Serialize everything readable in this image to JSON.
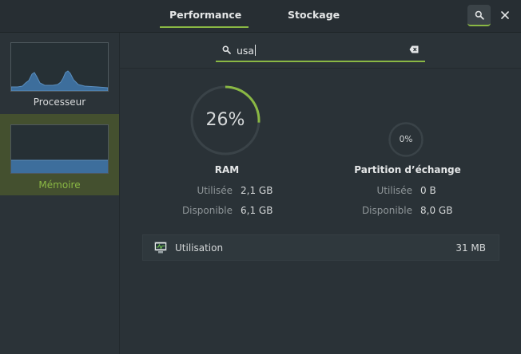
{
  "header": {
    "tabs": [
      {
        "label": "Performance",
        "active": true
      },
      {
        "label": "Stockage",
        "active": false
      }
    ],
    "search_icon": "search-icon",
    "close_icon": "close-icon"
  },
  "sidebar": {
    "items": [
      {
        "label": "Processeur",
        "selected": false
      },
      {
        "label": "Mémoire",
        "selected": true
      }
    ]
  },
  "search": {
    "value": "usa",
    "clear_icon": "backspace-clear-icon"
  },
  "memory": {
    "ram": {
      "title": "RAM",
      "percent_label": "26%",
      "percent": 26,
      "used_label": "Utilisée",
      "used_value": "2,1 GB",
      "available_label": "Disponible",
      "available_value": "6,1 GB"
    },
    "swap": {
      "title": "Partition d’échange",
      "percent_label": "0%",
      "percent": 0,
      "used_label": "Utilisée",
      "used_value": "0 B",
      "available_label": "Disponible",
      "available_value": "8,0 GB"
    }
  },
  "processes": [
    {
      "name": "Utilisation",
      "value": "31 MB",
      "icon": "system-monitor-icon"
    }
  ],
  "colors": {
    "accent": "#8ab844",
    "selected_bg": "#44502f",
    "graph_blue": "#3d6e9c"
  }
}
